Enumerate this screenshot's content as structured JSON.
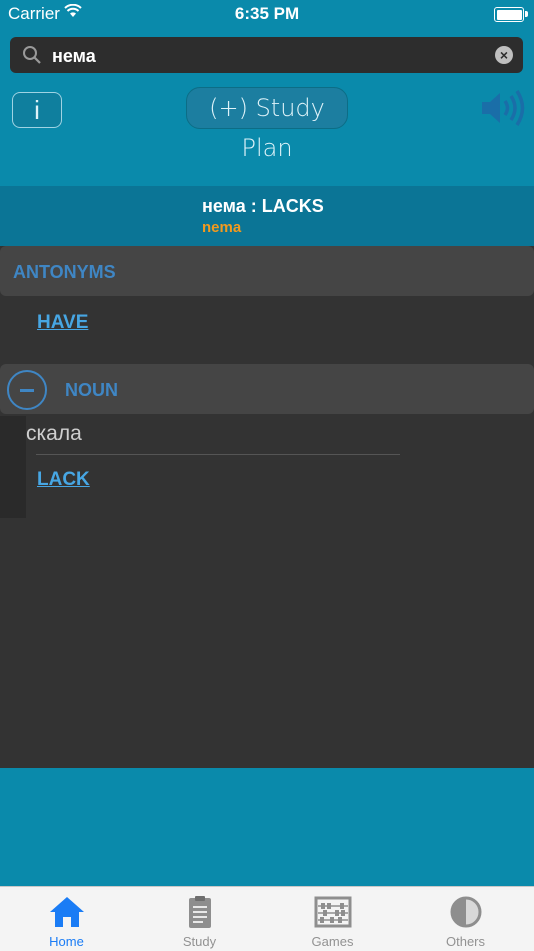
{
  "status_bar": {
    "carrier": "Carrier",
    "time": "6:35 PM"
  },
  "search": {
    "value": "нема",
    "icon": "search-icon",
    "clear_icon": "clear-icon"
  },
  "toolbar": {
    "info_label": "i",
    "study_plan_label": "(+) Study Plan",
    "speaker_icon": "speaker-icon"
  },
  "word": {
    "title": "нема : LACKS",
    "transliteration": "nema"
  },
  "sections": {
    "antonyms": {
      "header": "ANTONYMS",
      "items": [
        "HAVE"
      ]
    },
    "noun": {
      "header": "NOUN",
      "term": "скала",
      "items": [
        "LACK"
      ]
    }
  },
  "tabs": [
    {
      "label": "Home",
      "icon": "home-icon",
      "active": true
    },
    {
      "label": "Study",
      "icon": "clipboard-icon",
      "active": false
    },
    {
      "label": "Games",
      "icon": "abacus-icon",
      "active": false
    },
    {
      "label": "Others",
      "icon": "half-circle-icon",
      "active": false
    }
  ],
  "colors": {
    "header_blue": "#0a8aab",
    "word_bar": "#0b7596",
    "accent_orange": "#f39a1e",
    "section_label": "#3f86c4",
    "link": "#47a6e3",
    "tab_active": "#1a7cf5"
  }
}
